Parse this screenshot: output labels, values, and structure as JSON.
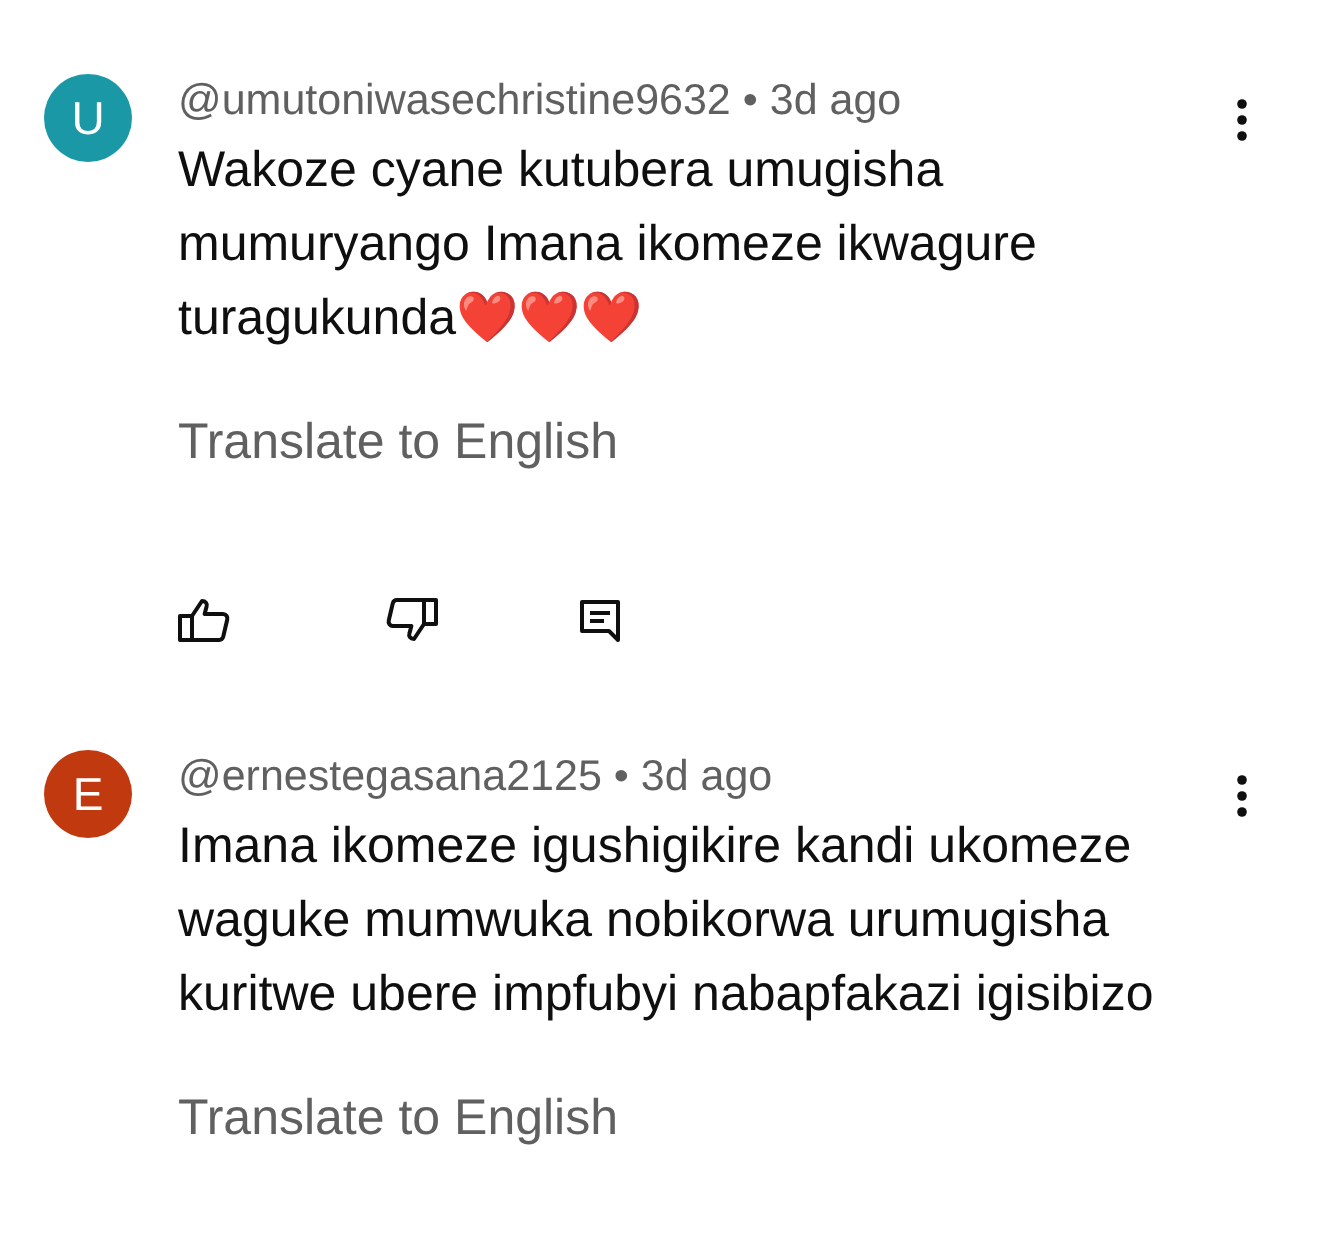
{
  "comments": [
    {
      "avatar_letter": "U",
      "color": "#1a98a6",
      "byline": "@umutoniwasechristine9632 • 3d ago",
      "text": "Wakoze cyane kutubera umugisha mumuryango Imana ikomeze ikwagure turagukunda❤️❤️❤️",
      "translate": "Translate to English",
      "actions_visible": true
    },
    {
      "avatar_letter": "E",
      "color": "#c0390f",
      "byline": "@ernestegasana2125 • 3d ago",
      "text": "Imana ikomeze igushigikire kandi ukomeze waguke mumwuka nobikorwa urumugisha kuritwe ubere impfubyi nabapfakazi igisibizo",
      "translate": "Translate to English",
      "actions_visible": false
    }
  ]
}
